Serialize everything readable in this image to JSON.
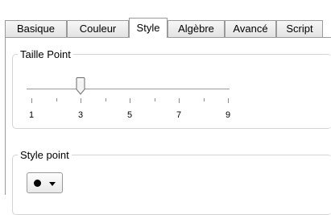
{
  "tabs": [
    {
      "label": "Basique",
      "active": false
    },
    {
      "label": "Couleur",
      "active": false
    },
    {
      "label": "Style",
      "active": true
    },
    {
      "label": "Algèbre",
      "active": false
    },
    {
      "label": "Avancé",
      "active": false
    },
    {
      "label": "Script",
      "active": false
    }
  ],
  "point_size": {
    "title": "Taille Point",
    "value": 3,
    "min": 1,
    "max": 9,
    "tick_labels": [
      "1",
      "3",
      "5",
      "7",
      "9"
    ]
  },
  "point_style": {
    "title": "Style point",
    "selected_icon": "filled-circle-icon"
  }
}
